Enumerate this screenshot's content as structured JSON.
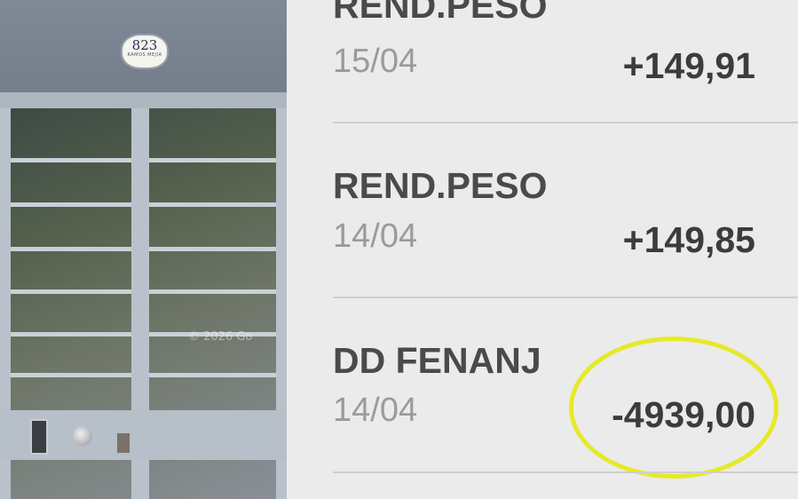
{
  "photo": {
    "house_number": "823",
    "plate_text": "RAMOS MEJIA",
    "watermark": "© 2026 Go"
  },
  "transactions": [
    {
      "description": "REND.PESO",
      "date": "15/04",
      "amount": "+149,91"
    },
    {
      "description": "REND.PESO",
      "date": "14/04",
      "amount": "+149,85"
    },
    {
      "description": "DD FENANJ",
      "date": "14/04",
      "amount": "-4939,00",
      "highlighted": true
    }
  ],
  "colors": {
    "highlight_circle": "#e6e92a",
    "background": "#ebebeb",
    "description_text": "#4a4a4a",
    "date_text": "#9b9b9b"
  }
}
